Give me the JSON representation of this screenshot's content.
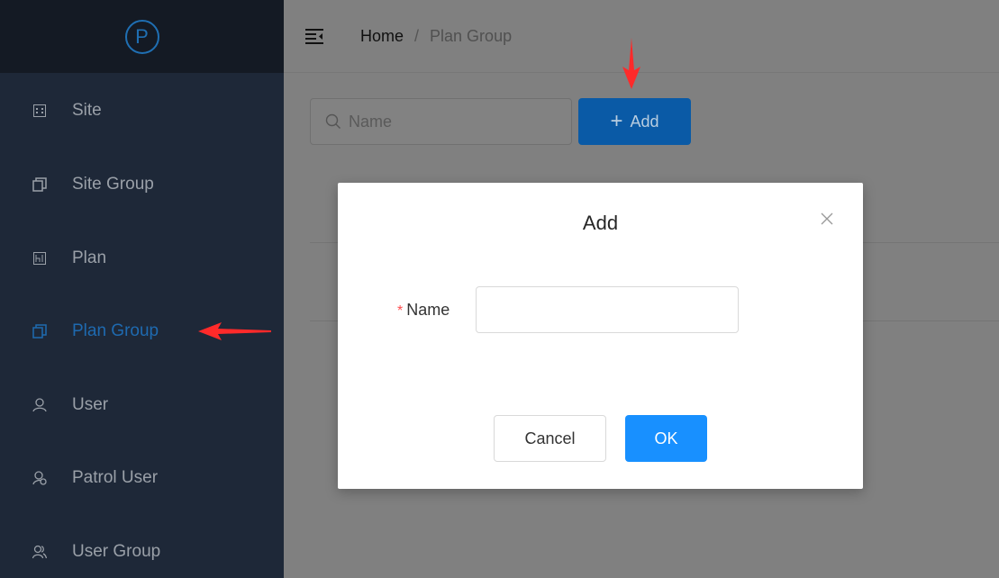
{
  "sidebar": {
    "logo_letter": "P",
    "items": [
      {
        "label": "Site",
        "icon": "site-icon"
      },
      {
        "label": "Site Group",
        "icon": "group-icon"
      },
      {
        "label": "Plan",
        "icon": "plan-icon"
      },
      {
        "label": "Plan Group",
        "icon": "group-icon",
        "active": true
      },
      {
        "label": "User",
        "icon": "user-icon"
      },
      {
        "label": "Patrol User",
        "icon": "patrol-user-icon"
      },
      {
        "label": "User Group",
        "icon": "user-group-icon"
      }
    ]
  },
  "header": {
    "breadcrumb": {
      "home": "Home",
      "separator": "/",
      "current": "Plan Group"
    }
  },
  "toolbar": {
    "search_placeholder": "Name",
    "add_label": "Add"
  },
  "modal": {
    "title": "Add",
    "name_label": "Name",
    "required_mark": "*",
    "name_value": "",
    "cancel_label": "Cancel",
    "ok_label": "OK"
  },
  "colors": {
    "sidebar_bg": "#1e2838",
    "active_item": "#1e6ab0",
    "primary": "#1890ff",
    "annotation_arrow": "#ff2a2a"
  }
}
